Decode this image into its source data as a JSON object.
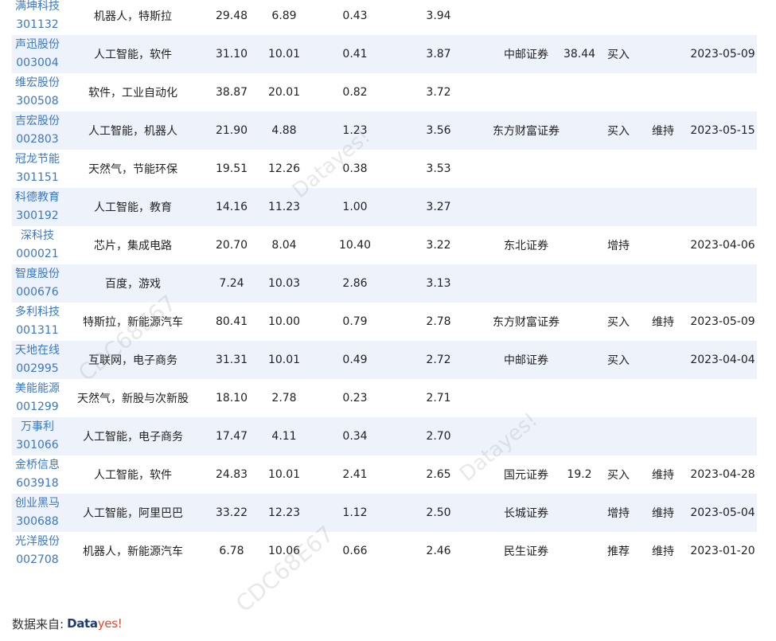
{
  "rows": [
    {
      "name": "满坤科技",
      "code": "301132",
      "tags": "机器人，特斯拉",
      "price": "29.48",
      "change": "6.89",
      "turnover": "0.43",
      "score": "3.94",
      "broker": "",
      "target": "",
      "rating": "",
      "action": "",
      "date": ""
    },
    {
      "name": "声迅股份",
      "code": "003004",
      "tags": "人工智能，软件",
      "price": "31.10",
      "change": "10.01",
      "turnover": "0.41",
      "score": "3.87",
      "broker": "中邮证券",
      "target": "38.44",
      "rating": "买入",
      "action": "",
      "date": "2023-05-09"
    },
    {
      "name": "维宏股份",
      "code": "300508",
      "tags": "软件，工业自动化",
      "price": "38.87",
      "change": "20.01",
      "turnover": "0.82",
      "score": "3.72",
      "broker": "",
      "target": "",
      "rating": "",
      "action": "",
      "date": ""
    },
    {
      "name": "吉宏股份",
      "code": "002803",
      "tags": "人工智能，机器人",
      "price": "21.90",
      "change": "4.88",
      "turnover": "1.23",
      "score": "3.56",
      "broker": "东方财富证券",
      "target": "",
      "rating": "买入",
      "action": "维持",
      "date": "2023-05-15"
    },
    {
      "name": "冠龙节能",
      "code": "301151",
      "tags": "天然气，节能环保",
      "price": "19.51",
      "change": "12.26",
      "turnover": "0.38",
      "score": "3.53",
      "broker": "",
      "target": "",
      "rating": "",
      "action": "",
      "date": ""
    },
    {
      "name": "科德教育",
      "code": "300192",
      "tags": "人工智能，教育",
      "price": "14.16",
      "change": "11.23",
      "turnover": "1.00",
      "score": "3.27",
      "broker": "",
      "target": "",
      "rating": "",
      "action": "",
      "date": ""
    },
    {
      "name": "深科技",
      "code": "000021",
      "tags": "芯片，集成电路",
      "price": "20.70",
      "change": "8.04",
      "turnover": "10.40",
      "score": "3.22",
      "broker": "东北证券",
      "target": "",
      "rating": "增持",
      "action": "",
      "date": "2023-04-06"
    },
    {
      "name": "智度股份",
      "code": "000676",
      "tags": "百度，游戏",
      "price": "7.24",
      "change": "10.03",
      "turnover": "2.86",
      "score": "3.13",
      "broker": "",
      "target": "",
      "rating": "",
      "action": "",
      "date": ""
    },
    {
      "name": "多利科技",
      "code": "001311",
      "tags": "特斯拉，新能源汽车",
      "price": "80.41",
      "change": "10.00",
      "turnover": "0.79",
      "score": "2.78",
      "broker": "东方财富证券",
      "target": "",
      "rating": "买入",
      "action": "维持",
      "date": "2023-05-09"
    },
    {
      "name": "天地在线",
      "code": "002995",
      "tags": "互联网，电子商务",
      "price": "31.31",
      "change": "10.01",
      "turnover": "0.49",
      "score": "2.72",
      "broker": "中邮证券",
      "target": "",
      "rating": "买入",
      "action": "",
      "date": "2023-04-04"
    },
    {
      "name": "美能能源",
      "code": "001299",
      "tags": "天然气，新股与次新股",
      "price": "18.10",
      "change": "2.78",
      "turnover": "0.23",
      "score": "2.71",
      "broker": "",
      "target": "",
      "rating": "",
      "action": "",
      "date": ""
    },
    {
      "name": "万事利",
      "code": "301066",
      "tags": "人工智能，电子商务",
      "price": "17.47",
      "change": "4.11",
      "turnover": "0.34",
      "score": "2.70",
      "broker": "",
      "target": "",
      "rating": "",
      "action": "",
      "date": ""
    },
    {
      "name": "金桥信息",
      "code": "603918",
      "tags": "人工智能，软件",
      "price": "24.83",
      "change": "10.01",
      "turnover": "2.41",
      "score": "2.65",
      "broker": "国元证券",
      "target": "19.2",
      "rating": "买入",
      "action": "维持",
      "date": "2023-04-28"
    },
    {
      "name": "创业黑马",
      "code": "300688",
      "tags": "人工智能，阿里巴巴",
      "price": "33.22",
      "change": "12.23",
      "turnover": "1.12",
      "score": "2.50",
      "broker": "长城证券",
      "target": "",
      "rating": "增持",
      "action": "维持",
      "date": "2023-05-04"
    },
    {
      "name": "光洋股份",
      "code": "002708",
      "tags": "机器人，新能源汽车",
      "price": "6.78",
      "change": "10.06",
      "turnover": "0.66",
      "score": "2.46",
      "broker": "民生证券",
      "target": "",
      "rating": "推荐",
      "action": "维持",
      "date": "2023-01-20"
    }
  ],
  "footer": {
    "source_label": "数据来自:",
    "logo_part1": "Data",
    "logo_part2": "yes!"
  },
  "watermarks": {
    "brand": "Datayes!",
    "code": "CDC68E67"
  }
}
